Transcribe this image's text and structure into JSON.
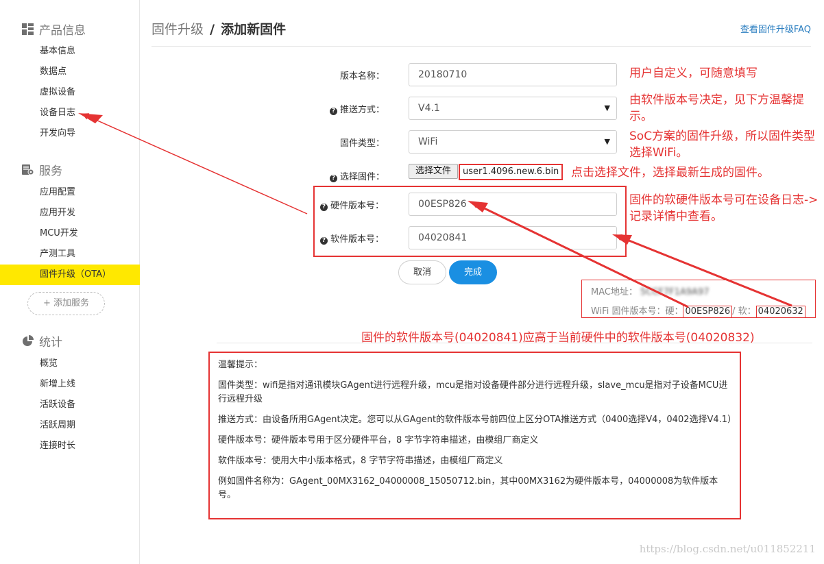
{
  "sidebar": {
    "sections": [
      {
        "title": "产品信息",
        "icon": "grid-icon",
        "items": [
          "基本信息",
          "数据点",
          "虚拟设备",
          "设备日志",
          "开发向导"
        ]
      },
      {
        "title": "服务",
        "icon": "service-icon",
        "items": [
          "应用配置",
          "应用开发",
          "MCU开发",
          "产测工具",
          "固件升级（OTA）"
        ]
      },
      {
        "title": "统计",
        "icon": "pie-icon",
        "items": [
          "概览",
          "新增上线",
          "活跃设备",
          "活跃周期",
          "连接时长"
        ]
      }
    ],
    "add_service": "+ 添加服务"
  },
  "header": {
    "crumb_parent": "固件升级",
    "crumb_sep": "/",
    "crumb_current": "添加新固件",
    "faq": "查看固件升级FAQ"
  },
  "form": {
    "version_name_label": "版本名称：",
    "version_name_value": "20180710",
    "push_label": "推送方式：",
    "push_value": "V4.1",
    "type_label": "固件类型：",
    "type_value": "WiFi",
    "file_label": "选择固件：",
    "file_button": "选择文件",
    "file_name": "user1.4096.new.6.bin",
    "hw_label": "硬件版本号：",
    "hw_value": "00ESP826",
    "sw_label": "软件版本号：",
    "sw_value": "04020841",
    "cancel": "取消",
    "done": "完成"
  },
  "device_info": {
    "mac_label": "MAC地址：",
    "mac_value": "5CCF7F1A9A97",
    "wifi_label": "WiFi 固件版本号：硬：",
    "wifi_hw": "00ESP826",
    "wifi_sep": "/ 软：",
    "wifi_sw": "04020632"
  },
  "annotations": {
    "a1": "用户自定义，可随意填写",
    "a2": "由软件版本号决定，见下方温馨提示。",
    "a3": "SoC方案的固件升级，所以固件类型选择WiFi。",
    "a4": "点击选择文件，选择最新生成的固件。",
    "a5": "固件的软硬件版本号可在设备日志->记录详情中查看。",
    "a6": "固件的软件版本号(04020841)应高于当前硬件中的软件版本号(04020832)"
  },
  "tips": {
    "title": "温馨提示：",
    "p1": "固件类型：wifi是指对通讯模块GAgent进行远程升级，mcu是指对设备硬件部分进行远程升级，slave_mcu是指对子设备MCU进行远程升级",
    "p2": "推送方式：由设备所用GAgent决定。您可以从GAgent的软件版本号前四位上区分OTA推送方式（0400选择V4，0402选择V4.1）",
    "p3": "硬件版本号：硬件版本号用于区分硬件平台，8 字节字符串描述，由模组厂商定义",
    "p4": "软件版本号：使用大中小版本格式，8 字节字符串描述，由模组厂商定义",
    "p5": "例如固件名称为：GAgent_00MX3162_04000008_15050712.bin，其中00MX3162为硬件版本号，04000008为软件版本号。"
  },
  "watermark": "https://blog.csdn.net/u011852211",
  "colors": {
    "accent": "#1a8fe2",
    "active": "#ffe800",
    "annotation": "#e53333"
  }
}
